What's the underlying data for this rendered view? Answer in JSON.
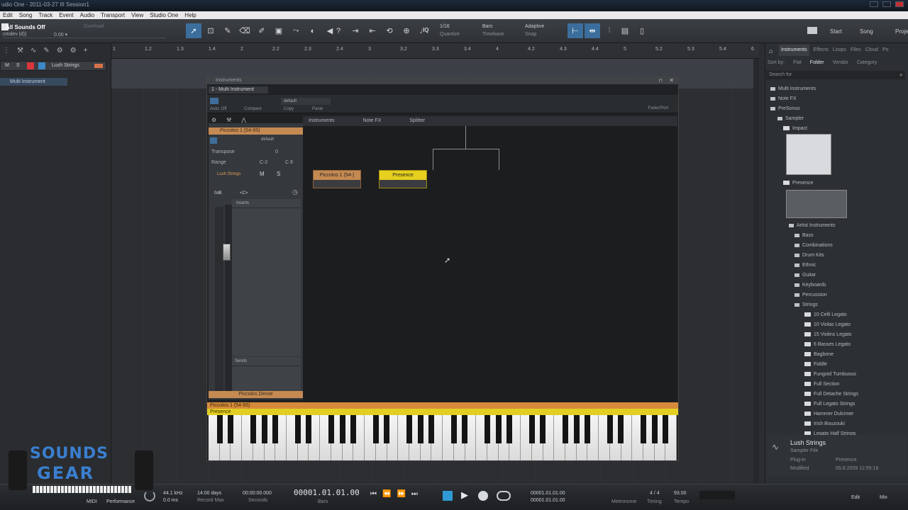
{
  "window": {
    "title": "udio One - 2011-03-27 III Session1"
  },
  "menu": [
    "Edit",
    "Song",
    "Track",
    "Event",
    "Audio",
    "Transport",
    "View",
    "Studio One",
    "Help"
  ],
  "song": {
    "name": "All Sounds Off",
    "status": "Overload",
    "sub": "cmdev (d))",
    "value": "0.00 ▾"
  },
  "toolbar": {
    "tools": [
      "arrow-icon",
      "range-icon",
      "pencil-icon",
      "eraser-icon",
      "paint-icon",
      "split-icon",
      "bend-icon",
      "mute-icon",
      "listen-icon"
    ],
    "tools2": [
      "help-icon",
      "quantize-start-icon",
      "quantize-end-icon",
      "loop-icon",
      "zoom-icon",
      "tempo-icon"
    ],
    "iq_label": "IQ",
    "quantize_value": "1/16",
    "quantize_label": "Quantize",
    "timebase_value": "Bars",
    "timebase_label": "Timebase",
    "snap_value": "Adaptive",
    "snap_label": "Snap",
    "start": "Start",
    "song": "Song",
    "project": "Project"
  },
  "track": {
    "name": "Lush Strings",
    "m": "M",
    "s": "S",
    "group": "Multi Instrument"
  },
  "ruler": [
    "1",
    "1.2",
    "1.3",
    "1.4",
    "2",
    "2.2",
    "2.3",
    "2.4",
    "3",
    "3.2",
    "3.3",
    "3.4",
    "4",
    "4.2",
    "4.3",
    "4.4",
    "5",
    "5.2",
    "5.3",
    "5.4",
    "6"
  ],
  "browser": {
    "tabs": [
      "Instruments",
      "Effects",
      "Loops",
      "Files",
      "Cloud",
      "Po"
    ],
    "sort_label": "Sort by:",
    "sort_flat": "Flat",
    "sort_folder": "Folder",
    "sort_vendor": "Vendor",
    "sort_category": "Category",
    "search": "Search for",
    "tree": [
      {
        "label": "Multi Instruments",
        "indent": 1,
        "kind": "folder"
      },
      {
        "label": "Note FX",
        "indent": 1,
        "kind": "folder"
      },
      {
        "label": "PreSonus",
        "indent": 1,
        "kind": "folder"
      },
      {
        "label": "Sampler",
        "indent": 2,
        "kind": "folder"
      },
      {
        "label": "Impact",
        "indent": 3,
        "kind": "plugin"
      }
    ],
    "tree2": [
      {
        "label": "Presence",
        "indent": 3,
        "kind": "plugin"
      }
    ],
    "tree3": [
      {
        "label": "Artist Instruments",
        "indent": 4,
        "kind": "folder"
      },
      {
        "label": "Bass",
        "indent": 5,
        "kind": "folder"
      },
      {
        "label": "Combinations",
        "indent": 5,
        "kind": "folder"
      },
      {
        "label": "Drum Kits",
        "indent": 5,
        "kind": "folder"
      },
      {
        "label": "Ethnic",
        "indent": 5,
        "kind": "folder"
      },
      {
        "label": "Guitar",
        "indent": 5,
        "kind": "folder"
      },
      {
        "label": "Keyboards",
        "indent": 5,
        "kind": "folder"
      },
      {
        "label": "Percussion",
        "indent": 5,
        "kind": "folder"
      },
      {
        "label": "Strings",
        "indent": 5,
        "kind": "folder"
      },
      {
        "label": "10 Celli Legato",
        "indent": 6,
        "kind": "preset"
      },
      {
        "label": "10 Violas Legato",
        "indent": 6,
        "kind": "preset"
      },
      {
        "label": "15 Violins Legato",
        "indent": 6,
        "kind": "preset"
      },
      {
        "label": "6 Basses Legato",
        "indent": 6,
        "kind": "preset"
      },
      {
        "label": "Bagbone",
        "indent": 6,
        "kind": "preset"
      },
      {
        "label": "Fiddle",
        "indent": 6,
        "kind": "preset"
      },
      {
        "label": "Fungoid Tumbuous",
        "indent": 6,
        "kind": "preset"
      },
      {
        "label": "Full Section",
        "indent": 6,
        "kind": "preset"
      },
      {
        "label": "Full Detache Strings",
        "indent": 6,
        "kind": "preset"
      },
      {
        "label": "Full Legato Strings",
        "indent": 6,
        "kind": "preset"
      },
      {
        "label": "Hammer Dulcimer",
        "indent": 6,
        "kind": "preset"
      },
      {
        "label": "Irish Bouzouki",
        "indent": 6,
        "kind": "preset"
      },
      {
        "label": "Legato Half Strings",
        "indent": 6,
        "kind": "preset"
      }
    ],
    "info": {
      "name": "Lush Strings",
      "type": "Sampler File",
      "plugin_label": "Plug-in",
      "plugin": "Presence",
      "modified_label": "Modified",
      "modified": "05.8.2009 12:55:18"
    }
  },
  "instwin": {
    "title": "Instruments",
    "tab": "1 - Multi Instrument",
    "autooff": "Auto: Off",
    "compare": "Compare",
    "copy": "Copy",
    "paste": "Paste",
    "preset": "default",
    "fader_port": "Fader/Port",
    "ch_head": "Piccolos 1 (54-95)",
    "ch_default": "default",
    "transpose_label": "Transpose",
    "transpose": "0",
    "range_label": "Range",
    "range_lo": "C-2",
    "range_hi": "C 8",
    "patch": "Lush Strings",
    "m": "M",
    "s": "S",
    "vol": "0dB",
    "pan": "<C>",
    "inserts": "Inserts",
    "sends": "Sends",
    "ch_footer": "Piccolos Dense",
    "rtabs": [
      "Instruments",
      "Note FX",
      "Splitter"
    ],
    "nodeA": "Piccolos 1 (54-)",
    "nodeB": "Presence",
    "kb1": "Piccolos 1 (54-95)",
    "kb2": "Presence"
  },
  "transport": {
    "midi": "MIDI",
    "performance": "Performance",
    "rate": "44.1 kHz",
    "rate_sub": "0.0 ms",
    "rec_days": "14:00 days",
    "rec_label": "Record Max",
    "seconds": "00:00:00.000",
    "seconds_label": "Seconds",
    "bars": "00001.01.01.00",
    "bars_label": "Bars",
    "loop_l": "00001.01.01.00",
    "loop_r": "00001.01.01.00",
    "metronome_label": "Metronome",
    "sig": "4 / 4",
    "sig_label": "Timing",
    "tempo": "93.00",
    "tempo_label": "Tempo",
    "edit": "Edit",
    "mix": "Mix",
    "browse": "Browse"
  },
  "logo": {
    "line1": "SOUNDS",
    "line2": "GEAR"
  }
}
